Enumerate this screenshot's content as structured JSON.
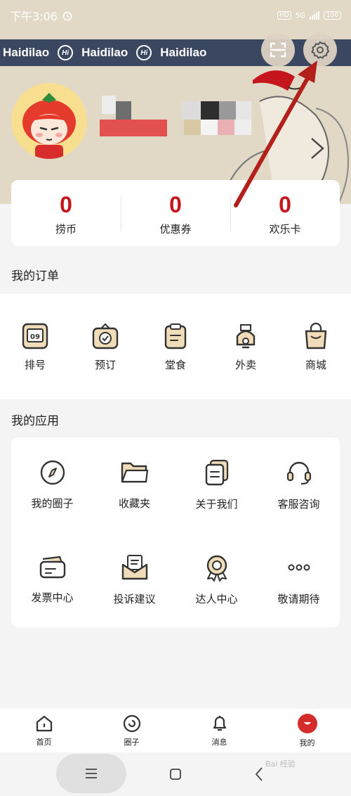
{
  "status_bar": {
    "time": "下午3:06",
    "hd": "HD",
    "network": "5G",
    "battery": "100"
  },
  "header": {
    "brand_text": "Haidilao",
    "brand_mark": "Hi"
  },
  "stats": [
    {
      "value": "0",
      "label": "捞币"
    },
    {
      "value": "0",
      "label": "优惠券"
    },
    {
      "value": "0",
      "label": "欢乐卡"
    }
  ],
  "orders": {
    "title": "我的订单",
    "items": [
      {
        "label": "排号",
        "icon": "queue-number-icon",
        "badge": "09"
      },
      {
        "label": "预订",
        "icon": "reservation-icon"
      },
      {
        "label": "堂食",
        "icon": "dine-in-icon"
      },
      {
        "label": "外卖",
        "icon": "delivery-icon"
      },
      {
        "label": "商城",
        "icon": "shop-bag-icon"
      }
    ]
  },
  "apps": {
    "title": "我的应用",
    "items": [
      {
        "label": "我的圈子",
        "icon": "compass-icon"
      },
      {
        "label": "收藏夹",
        "icon": "folder-icon"
      },
      {
        "label": "关于我们",
        "icon": "document-icon"
      },
      {
        "label": "客服咨询",
        "icon": "headset-icon"
      },
      {
        "label": "发票中心",
        "icon": "invoice-icon"
      },
      {
        "label": "投诉建议",
        "icon": "mail-icon"
      },
      {
        "label": "达人中心",
        "icon": "award-icon"
      },
      {
        "label": "敬请期待",
        "icon": "more-icon"
      }
    ]
  },
  "bottom_nav": [
    {
      "label": "首页",
      "icon": "home-icon"
    },
    {
      "label": "圈子",
      "icon": "circle-icon"
    },
    {
      "label": "消息",
      "icon": "bell-icon"
    },
    {
      "label": "我的",
      "icon": "profile-icon"
    }
  ],
  "watermark": "Bai 经验",
  "colors": {
    "accent": "#c4161c",
    "banner": "#3b4660",
    "header_bg": "#e2d8c6",
    "icon_fill": "#f0dcb8"
  }
}
